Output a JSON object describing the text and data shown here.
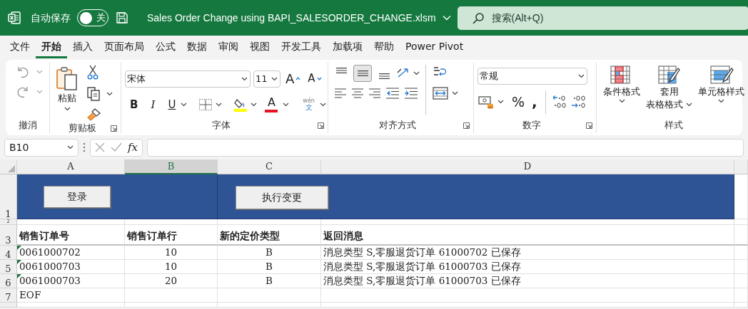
{
  "window": {
    "title": "Sales Order Change using BAPI_SALESORDER_CHANGE.xlsm",
    "autosave_label": "自动保存",
    "autosave": {
      "on": false,
      "label": "关"
    },
    "search_placeholder": "搜索(Alt+Q)"
  },
  "menu_tabs": [
    {
      "label": "文件",
      "selected": false
    },
    {
      "label": "开始",
      "selected": true
    },
    {
      "label": "插入",
      "selected": false
    },
    {
      "label": "页面布局",
      "selected": false
    },
    {
      "label": "公式",
      "selected": false
    },
    {
      "label": "数据",
      "selected": false
    },
    {
      "label": "审阅",
      "selected": false
    },
    {
      "label": "视图",
      "selected": false
    },
    {
      "label": "开发工具",
      "selected": false
    },
    {
      "label": "加载项",
      "selected": false
    },
    {
      "label": "帮助",
      "selected": false
    },
    {
      "label": "Power Pivot",
      "selected": false
    }
  ],
  "ribbon": {
    "undo": {
      "label": "撤消"
    },
    "clipboard": {
      "label": "剪贴板",
      "paste": "粘贴"
    },
    "font": {
      "label": "字体",
      "font_name": "宋体",
      "font_size": "11",
      "grow": "A",
      "shrink": "A",
      "bold": "B",
      "italic": "I",
      "underline": "U",
      "font_color": "A",
      "phonetic_top": "wén",
      "phonetic_bottom": "文"
    },
    "alignment": {
      "label": "对齐方式",
      "vertical": [
        {
          "selected": false
        },
        {
          "selected": true
        },
        {
          "selected": false
        }
      ]
    },
    "number": {
      "label": "数字",
      "format": "常规",
      "percent": "%",
      "comma": ","
    },
    "styles": {
      "label": "样式",
      "buttons": [
        {
          "lines": [
            "条件格式"
          ],
          "kind": "conditional"
        },
        {
          "lines": [
            "套用",
            "表格格式"
          ],
          "kind": "table"
        },
        {
          "lines": [
            "单元格样式"
          ],
          "kind": "cell"
        }
      ]
    }
  },
  "formula_bar": {
    "name_box": "B10",
    "fx": "fx"
  },
  "sheet": {
    "columns": [
      {
        "label": "A",
        "selected": false
      },
      {
        "label": "B",
        "selected": true
      },
      {
        "label": "C",
        "selected": false
      },
      {
        "label": "D",
        "selected": false
      }
    ],
    "row_numbers": [
      "1",
      "2",
      "3",
      "4",
      "5",
      "6",
      "7"
    ],
    "buttons": [
      {
        "label": "登录"
      },
      {
        "label": "执行变更"
      }
    ],
    "headers": [
      "销售订单号",
      "销售订单行",
      "新的定价类型",
      "返回消息"
    ],
    "rows": [
      {
        "cells": [
          "0061000702",
          "10",
          "B",
          "消息类型 S,零服退货订单 61000702 已保存"
        ],
        "flagged": true
      },
      {
        "cells": [
          "0061000703",
          "10",
          "B",
          "消息类型 S,零服退货订单 61000703 已保存"
        ],
        "flagged": true
      },
      {
        "cells": [
          "0061000703",
          "20",
          "B",
          "消息类型 S,零服退货订单 61000703 已保存"
        ],
        "flagged": true
      }
    ],
    "footer": "EOF"
  }
}
